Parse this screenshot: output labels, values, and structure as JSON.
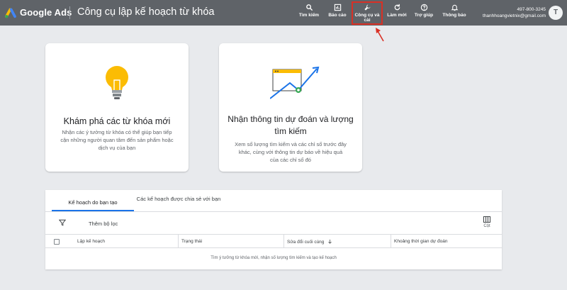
{
  "header": {
    "brand": "Google Ads",
    "page_title": "Công cụ lập kế hoạch từ khóa",
    "tools": [
      {
        "label": "Tìm kiếm",
        "icon": "search-icon"
      },
      {
        "label": "Báo cáo",
        "icon": "reports-icon"
      },
      {
        "label": "Công cụ và cài",
        "icon": "wrench-icon"
      },
      {
        "label": "Làm mới",
        "icon": "refresh-icon"
      },
      {
        "label": "Trợ giúp",
        "icon": "help-icon"
      },
      {
        "label": "Thông báo",
        "icon": "bell-icon"
      }
    ],
    "account": {
      "phone": "497-800-3245",
      "email": "thanhhoangvietnix@gmail.com",
      "avatar_initial": "T"
    },
    "highlight_color": "#d93025"
  },
  "cards": [
    {
      "title": "Khám phá các từ khóa mới",
      "description": "Nhận các ý tưởng từ khóa có thể giúp bạn tiếp cận những người quan tâm đến sản phẩm hoặc dịch vụ của bạn",
      "icon": "lightbulb-icon"
    },
    {
      "title": "Nhận thông tin dự đoán và lượng tìm kiếm",
      "description": "Xem số lượng tìm kiếm và các chỉ số trước đây khác, cùng với thông tin dự báo về hiệu quả của các chỉ số đó",
      "icon": "trend-chart-icon"
    }
  ],
  "plans": {
    "tabs": [
      "Kế hoạch do bạn tạo",
      "Các kế hoạch được chia sẻ với bạn"
    ],
    "filter_label": "Thêm bộ lọc",
    "columns_label": "Cột",
    "table_headers": [
      "Lập kế hoạch",
      "Trạng thái",
      "Sửa đổi cuối cùng",
      "Khoảng thời gian dự đoán"
    ],
    "empty_message": "Tìm ý tưởng từ khóa mới, nhận số lượng tìm kiếm và tạo kế hoạch"
  },
  "colors": {
    "topbar": "#5f6368",
    "accent": "#1a73e8",
    "bulb": "#fbbc04"
  }
}
